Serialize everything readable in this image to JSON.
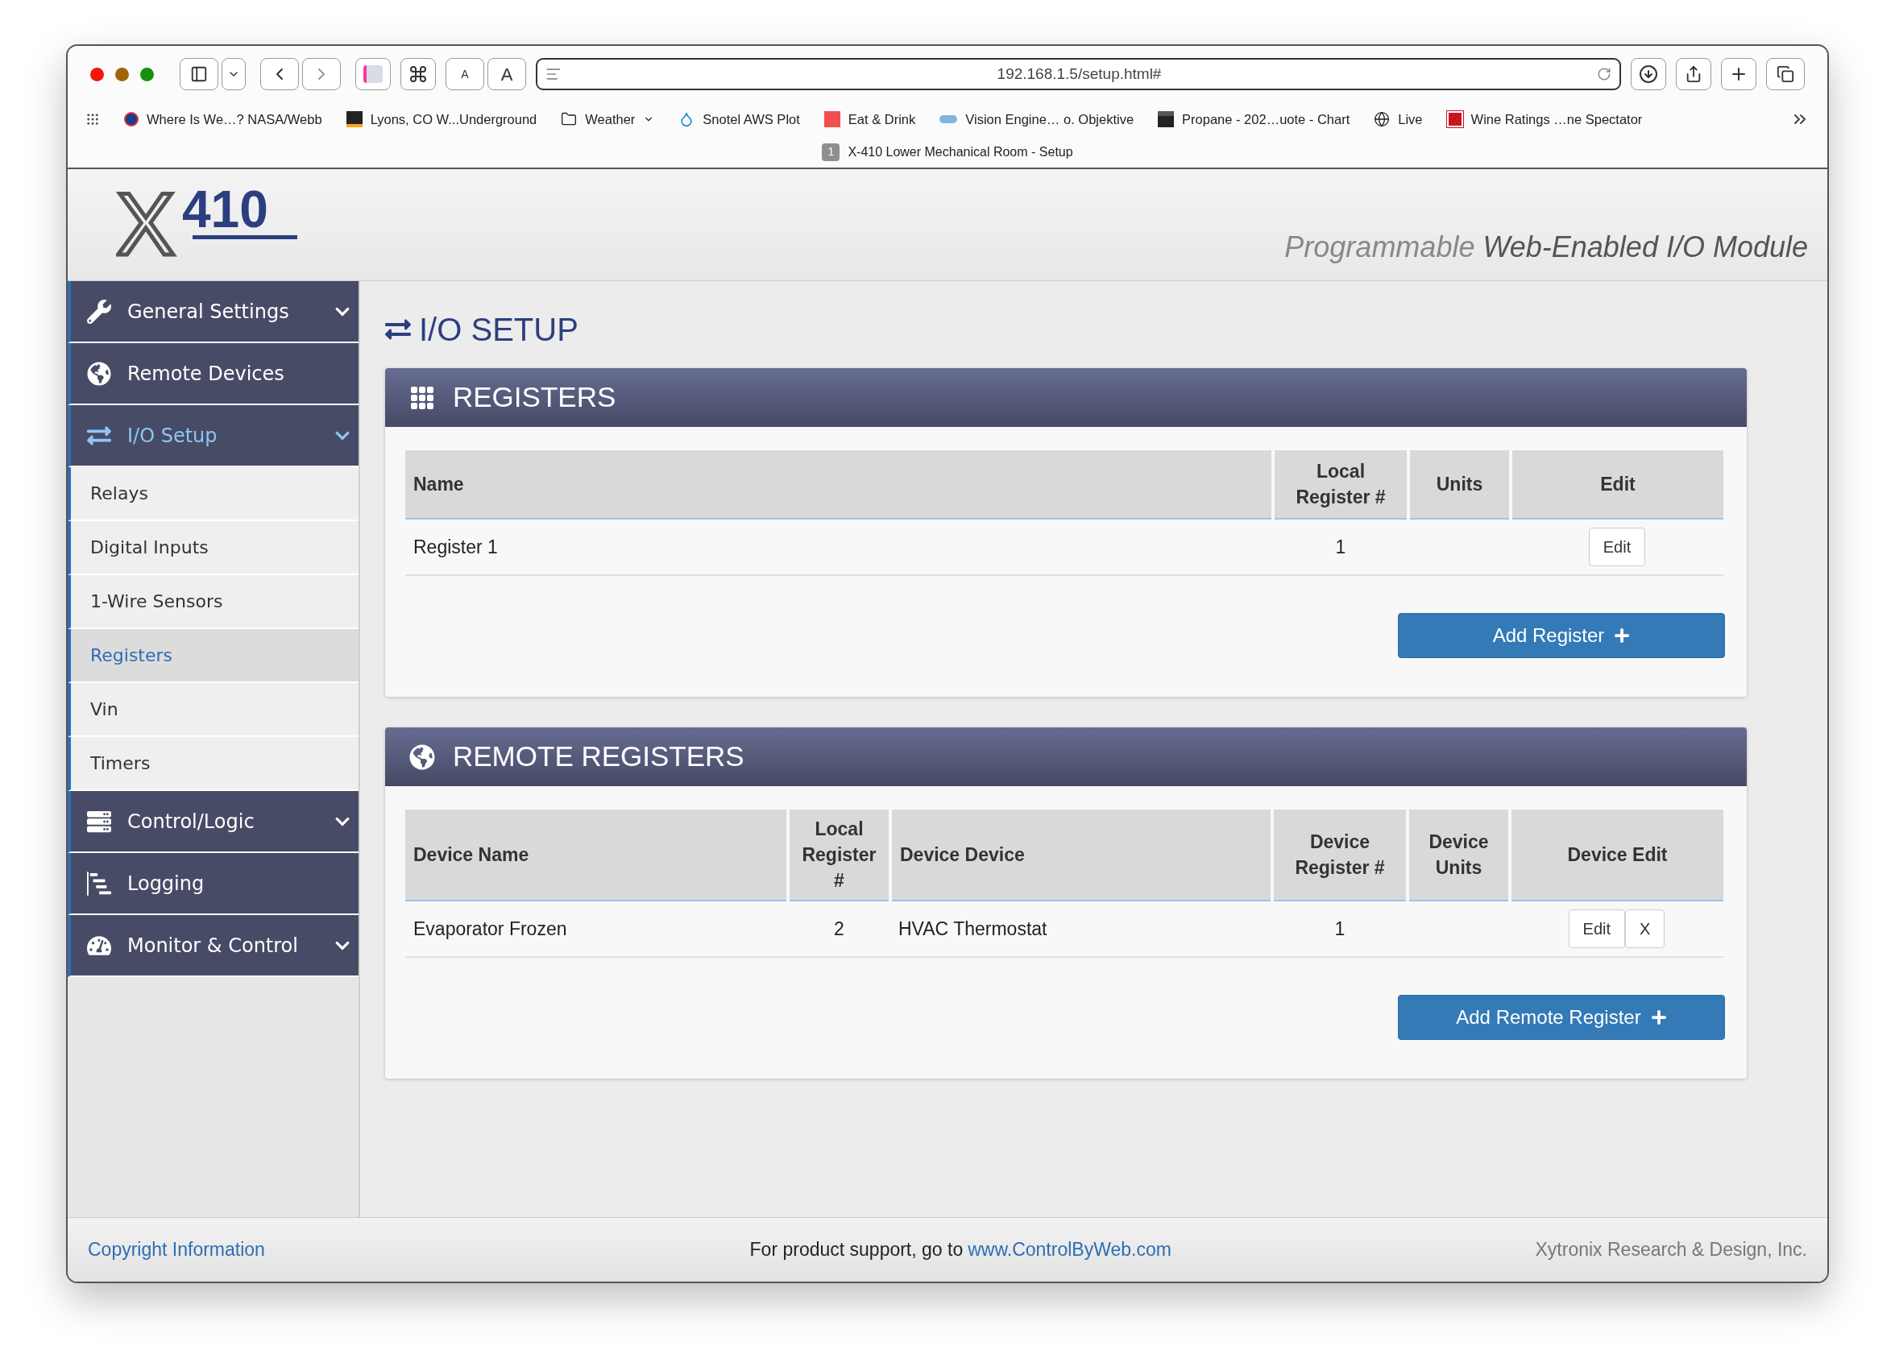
{
  "browser": {
    "text_size_buttons": [
      "A",
      "A"
    ],
    "url": "192.168.1.5/setup.html#",
    "bookmarks": [
      {
        "label": "Where Is We…? NASA/Webb",
        "kind": "nasa"
      },
      {
        "label": "Lyons, CO W...Underground",
        "kind": "wu"
      },
      {
        "label": "Weather",
        "kind": "folder"
      },
      {
        "label": "Snotel AWS Plot",
        "kind": "drop"
      },
      {
        "label": "Eat & Drink",
        "kind": "red"
      },
      {
        "label": "Vision Engine… o. Objektive",
        "kind": "cloud"
      },
      {
        "label": "Propane - 202…uote - Chart",
        "kind": "te"
      },
      {
        "label": "Live",
        "kind": "globe"
      },
      {
        "label": "Wine Ratings …ne Spectator",
        "kind": "ws"
      }
    ],
    "tab": {
      "number": "1",
      "title": "X-410 Lower Mechanical Room - Setup"
    }
  },
  "header": {
    "logo": {
      "letter": "X",
      "number": "410"
    },
    "tagline_light": "Programmable",
    "tagline_strong": "Web-Enabled I/O Module"
  },
  "sidebar": {
    "items": [
      {
        "label": "General Settings",
        "expandable": true,
        "selected": false
      },
      {
        "label": "Remote Devices",
        "expandable": false,
        "selected": false
      },
      {
        "label": "I/O Setup",
        "expandable": true,
        "selected": true,
        "children": [
          {
            "label": "Relays",
            "selected": false
          },
          {
            "label": "Digital Inputs",
            "selected": false
          },
          {
            "label": "1-Wire Sensors",
            "selected": false
          },
          {
            "label": "Registers",
            "selected": true
          },
          {
            "label": "Vin",
            "selected": false
          },
          {
            "label": "Timers",
            "selected": false
          }
        ]
      },
      {
        "label": "Control/Logic",
        "expandable": true,
        "selected": false
      },
      {
        "label": "Logging",
        "expandable": false,
        "selected": false
      },
      {
        "label": "Monitor & Control",
        "expandable": true,
        "selected": false
      }
    ]
  },
  "page_title": "I/O SETUP",
  "registers": {
    "title": "REGISTERS",
    "columns": [
      "Name",
      "Local Register #",
      "Units",
      "Edit"
    ],
    "rows": [
      {
        "name": "Register 1",
        "local_register": "1",
        "buttons": [
          "Edit"
        ]
      }
    ],
    "add_button": "Add Register"
  },
  "remote_registers": {
    "title": "REMOTE REGISTERS",
    "columns": [
      "Device Name",
      "Local Register #",
      "Device Device",
      "Device Register #",
      "Device Units",
      "Device Edit"
    ],
    "rows": [
      {
        "device_name": "Evaporator Frozen",
        "local_register": "2",
        "device": "HVAC Thermostat",
        "device_register": "1",
        "buttons": [
          "Edit",
          "X"
        ]
      }
    ],
    "add_button": "Add Remote Register"
  },
  "footer": {
    "copyright_link": "Copyright Information",
    "support_text": "For product support, go to",
    "support_link": "www.ControlByWeb.com",
    "company": "Xytronix Research & Design, Inc."
  }
}
